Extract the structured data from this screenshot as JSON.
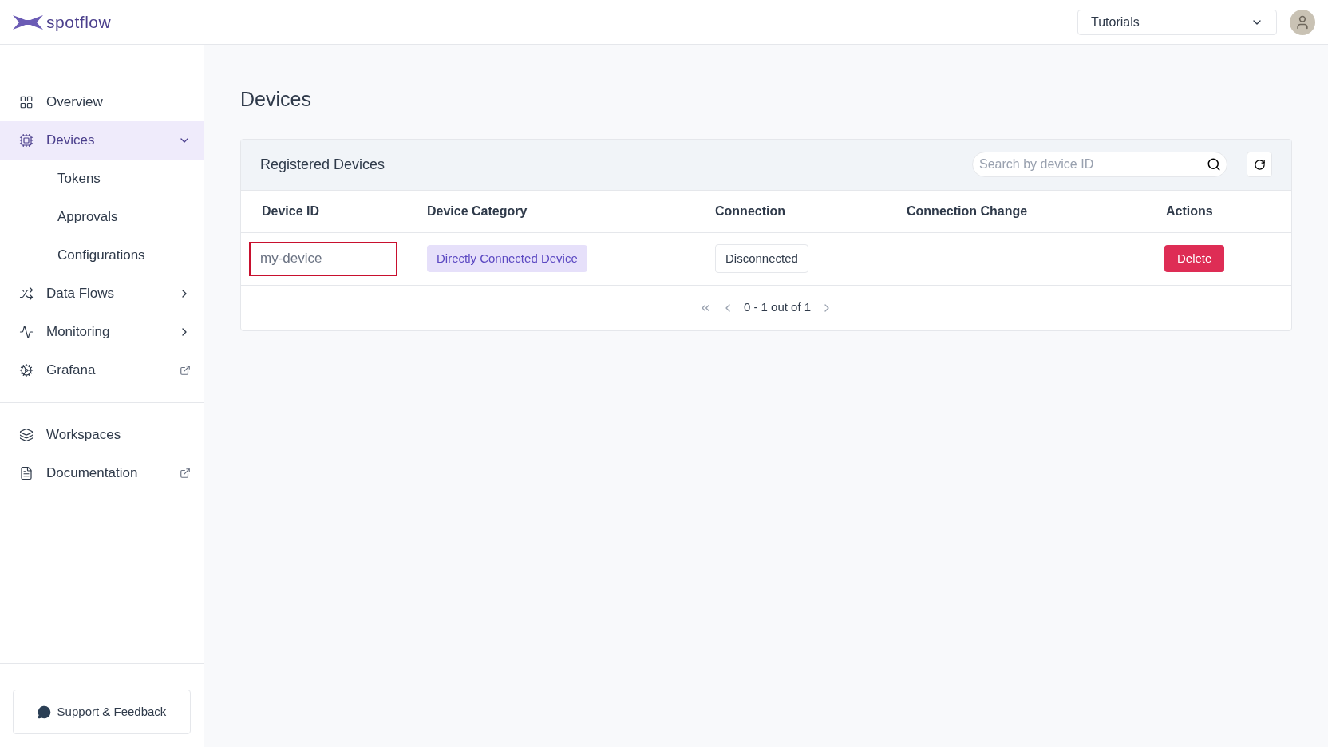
{
  "header": {
    "brand": "spotflow",
    "workspace_select": {
      "value": "Tutorials"
    }
  },
  "sidebar": {
    "items": [
      {
        "label": "Overview",
        "kind": "link",
        "selected": false
      },
      {
        "label": "Devices",
        "kind": "expandable",
        "selected": true,
        "expanded": true,
        "children": [
          {
            "label": "Tokens",
            "selected": false
          },
          {
            "label": "Approvals",
            "selected": false
          },
          {
            "label": "Configurations",
            "selected": false
          }
        ]
      },
      {
        "label": "Data Flows",
        "kind": "expandable",
        "selected": false,
        "expanded": false
      },
      {
        "label": "Monitoring",
        "kind": "expandable",
        "selected": false,
        "expanded": false
      },
      {
        "label": "Grafana",
        "kind": "external",
        "selected": false
      }
    ],
    "secondary_items": [
      {
        "label": "Workspaces",
        "kind": "link",
        "selected": false
      },
      {
        "label": "Documentation",
        "kind": "external",
        "selected": false
      }
    ],
    "support_button": "Support & Feedback"
  },
  "page": {
    "title": "Devices"
  },
  "card": {
    "title": "Registered Devices",
    "search": {
      "placeholder": "Search by device ID"
    },
    "table": {
      "columns": [
        "Device ID",
        "Device Category",
        "Connection",
        "Connection Change",
        "Actions"
      ],
      "rows": [
        {
          "device_id": "my-device",
          "highlighted": true,
          "category": "Directly Connected Device",
          "connection": "Disconnected",
          "connection_change": "",
          "action": "Delete"
        }
      ]
    },
    "pagination": "0 - 1 out of 1"
  }
}
